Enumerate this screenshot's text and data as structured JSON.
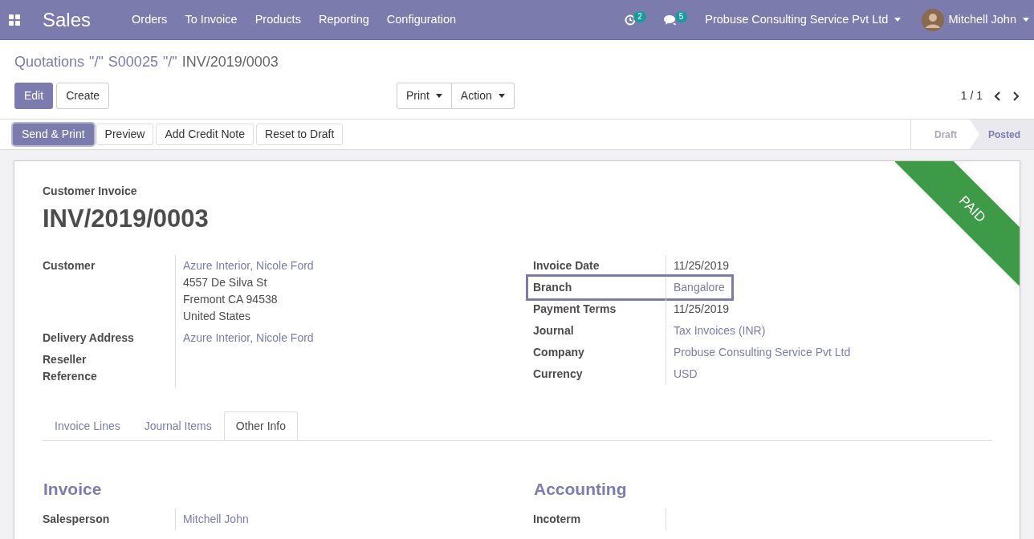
{
  "navbar": {
    "app_title": "Sales",
    "menu": [
      "Orders",
      "To Invoice",
      "Products",
      "Reporting",
      "Configuration"
    ],
    "activity_count": "2",
    "message_count": "5",
    "company": "Probuse Consulting Service Pvt Ltd",
    "user": "Mitchell John"
  },
  "breadcrumb": [
    {
      "kind": "link",
      "label": "Quotations"
    },
    {
      "kind": "separator",
      "label": "\"/\""
    },
    {
      "kind": "link",
      "label": "S00025"
    },
    {
      "kind": "separator",
      "label": "\"/\""
    },
    {
      "kind": "current",
      "label": "INV/2019/0003"
    }
  ],
  "toolbar": {
    "left": [
      {
        "label": "Edit",
        "kind": "primary"
      },
      {
        "label": "Create",
        "kind": "secondary"
      }
    ],
    "dropdowns": [
      "Print",
      "Action"
    ],
    "pager": "1 / 1"
  },
  "actions": [
    {
      "label": "Send & Print",
      "kind": "primary"
    },
    {
      "label": "Preview",
      "kind": "secondary"
    },
    {
      "label": "Add Credit Note",
      "kind": "secondary"
    },
    {
      "label": "Reset to Draft",
      "kind": "secondary"
    }
  ],
  "stages": [
    {
      "label": "Draft",
      "selected": false
    },
    {
      "label": "Posted",
      "selected": true
    }
  ],
  "sheet": {
    "subtitle": "Customer Invoice",
    "title": "INV/2019/0003",
    "ribbon": "PAID",
    "left_fields": [
      {
        "label": "Customer",
        "values": [
          {
            "text": "Azure Interior, Nicole Ford",
            "link": true
          },
          {
            "text": "4557 De Silva St",
            "link": false
          },
          {
            "text": "Fremont CA 94538",
            "link": false
          },
          {
            "text": "United States",
            "link": false
          }
        ],
        "highlighted": false
      },
      {
        "label": "Delivery Address",
        "values": [
          {
            "text": "Azure Interior, Nicole Ford",
            "link": true
          }
        ],
        "highlighted": false
      },
      {
        "label": "Reseller Reference",
        "highlighted": false
      }
    ],
    "right_fields": [
      {
        "label": "Invoice Date",
        "values": [
          {
            "text": "11/25/2019",
            "link": false
          }
        ],
        "highlighted": false
      },
      {
        "label": "Branch",
        "values": [
          {
            "text": "Bangalore",
            "link": true
          }
        ],
        "highlighted": true
      },
      {
        "label": "Payment Terms",
        "values": [
          {
            "text": "11/25/2019",
            "link": false
          }
        ],
        "highlighted": false
      },
      {
        "label": "Journal",
        "values": [
          {
            "text": "Tax Invoices (INR)",
            "link": true
          }
        ],
        "highlighted": false
      },
      {
        "label": "Company",
        "values": [
          {
            "text": "Probuse Consulting Service Pvt Ltd",
            "link": true
          }
        ],
        "highlighted": false
      },
      {
        "label": "Currency",
        "values": [
          {
            "text": "USD",
            "link": true
          }
        ],
        "highlighted": false
      }
    ],
    "tabs": [
      {
        "label": "Invoice Lines",
        "selected": false
      },
      {
        "label": "Journal Items",
        "selected": false
      },
      {
        "label": "Other Info",
        "selected": true
      }
    ],
    "sections": [
      {
        "title": "Invoice",
        "fields": [
          {
            "label": "Salesperson",
            "values": [
              {
                "text": "Mitchell John",
                "link": true
              }
            ],
            "highlighted": false
          }
        ]
      },
      {
        "title": "Accounting",
        "fields": [
          {
            "label": "Incoterm",
            "highlighted": false
          }
        ]
      }
    ]
  }
}
